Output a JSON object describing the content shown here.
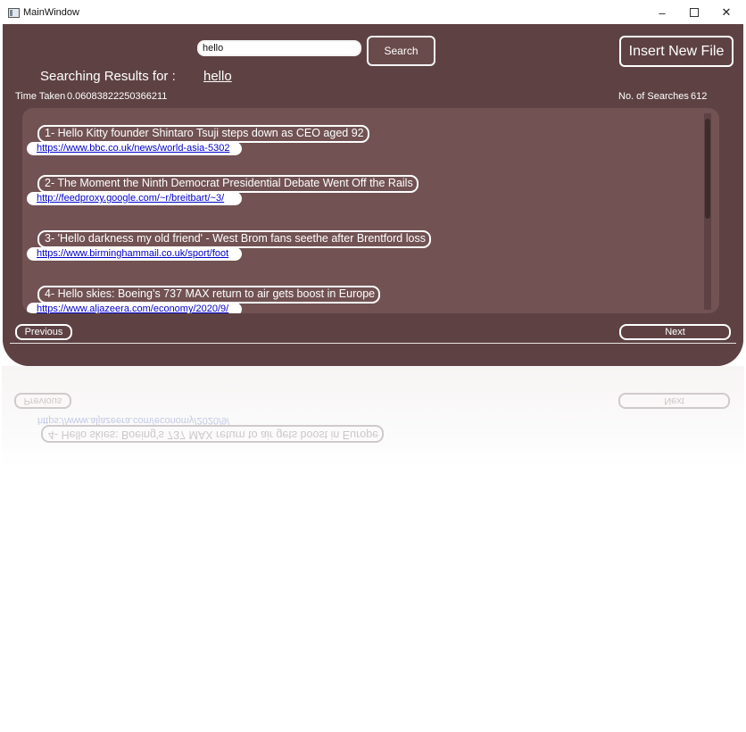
{
  "window": {
    "title": "MainWindow",
    "controls": {
      "minimize": "–",
      "maximize": "",
      "close": "✕"
    }
  },
  "search": {
    "input_value": "hello",
    "button_label": "Search"
  },
  "toolbar": {
    "insert_label": "Insert New File"
  },
  "results_header": {
    "label": "Searching Results for :",
    "query": "hello"
  },
  "stats": {
    "time_label": "Time Taken",
    "time_value": "0.06083822250366211",
    "searches_label": "No. of Searches",
    "searches_value": "612"
  },
  "results": [
    {
      "title": "1- Hello Kitty founder Shintaro Tsuji steps down as CEO aged 92",
      "url": "https://www.bbc.co.uk/news/world-asia-5302"
    },
    {
      "title": "2- The Moment the Ninth Democrat Presidential Debate Went Off the Rails",
      "url": "http://feedproxy.google.com/~r/breitbart/~3/"
    },
    {
      "title": "3- 'Hello darkness my old friend' - West Brom fans seethe after Brentford loss",
      "url": "https://www.birminghammail.co.uk/sport/foot"
    },
    {
      "title": "4- Hello skies: Boeing’s 737 MAX return to air gets boost in Europe",
      "url": "https://www.aljazeera.com/economy/2020/9/"
    }
  ],
  "pagination": {
    "previous_label": "Previous",
    "next_label": "Next"
  }
}
